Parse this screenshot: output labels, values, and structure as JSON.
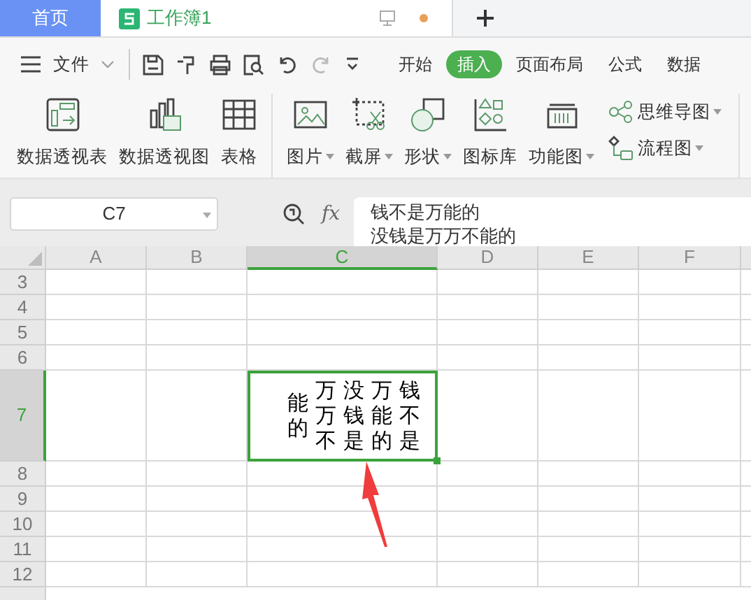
{
  "tabs": [
    {
      "label": "首页",
      "selected": false,
      "kind": "home"
    },
    {
      "label": "工作簿1",
      "selected": true,
      "kind": "doc",
      "unsaved": true
    }
  ],
  "menu": {
    "file_label": "文件",
    "ribbon_tabs": [
      {
        "label": "开始",
        "selected": false
      },
      {
        "label": "插入",
        "selected": true
      },
      {
        "label": "页面布局",
        "selected": false
      },
      {
        "label": "公式",
        "selected": false
      },
      {
        "label": "数据",
        "selected": false
      }
    ]
  },
  "ribbon": {
    "large_groups": [
      [
        {
          "label": "数据透视表",
          "dropdown": false
        },
        {
          "label": "数据透视图",
          "dropdown": false
        },
        {
          "label": "表格",
          "dropdown": false
        }
      ],
      [
        {
          "label": "图片",
          "dropdown": true
        },
        {
          "label": "截屏",
          "dropdown": true
        },
        {
          "label": "形状",
          "dropdown": true
        },
        {
          "label": "图标库",
          "dropdown": false
        },
        {
          "label": "功能图",
          "dropdown": true
        }
      ]
    ],
    "small": [
      {
        "label": "思维导图",
        "dropdown": true
      },
      {
        "label": "流程图",
        "dropdown": true
      }
    ]
  },
  "name_box": "C7",
  "formula": {
    "function_label": "fx",
    "lines": [
      "钱不是万能的",
      "没钱是万万不能的"
    ]
  },
  "columns": [
    {
      "label": "A",
      "selected": false
    },
    {
      "label": "B",
      "selected": false
    },
    {
      "label": "C",
      "selected": true
    },
    {
      "label": "D",
      "selected": false
    },
    {
      "label": "E",
      "selected": false
    },
    {
      "label": "F",
      "selected": false
    }
  ],
  "rows": [
    {
      "label": "3",
      "selected": false
    },
    {
      "label": "4",
      "selected": false
    },
    {
      "label": "5",
      "selected": false
    },
    {
      "label": "6",
      "selected": false
    },
    {
      "label": "7",
      "selected": true,
      "active_cell_text": [
        "能的",
        "万万不",
        "没钱是",
        "万能的",
        "钱不是"
      ]
    },
    {
      "label": "8",
      "selected": false
    },
    {
      "label": "9",
      "selected": false
    },
    {
      "label": "10",
      "selected": false
    },
    {
      "label": "11",
      "selected": false
    },
    {
      "label": "12",
      "selected": false
    }
  ]
}
